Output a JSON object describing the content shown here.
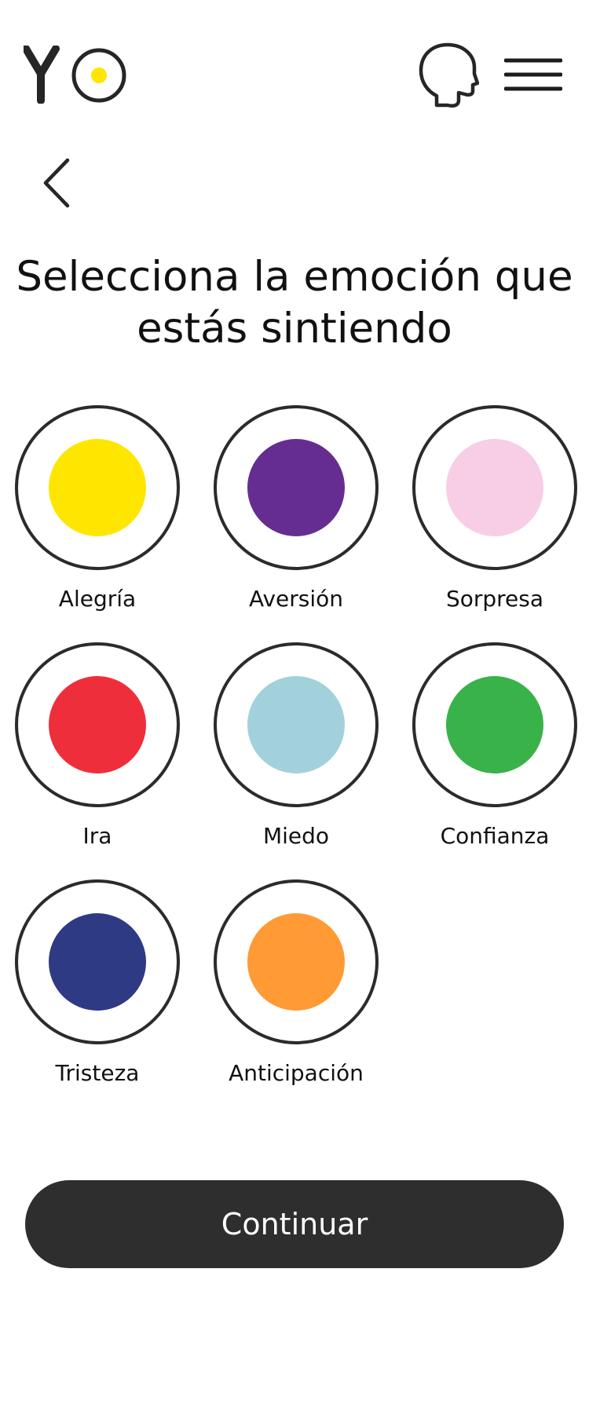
{
  "header": {
    "logo_icon": "yo-egg-logo",
    "logo_yolk_color": "#FFE500",
    "head_icon": "head-profile-icon",
    "menu_icon": "hamburger-menu-icon"
  },
  "navigation": {
    "back_icon": "chevron-left-icon"
  },
  "title": "Selecciona la emoción que estás sintiendo",
  "emotions": [
    {
      "label": "Alegría",
      "color": "#FFE600"
    },
    {
      "label": "Aversión",
      "color": "#662D91"
    },
    {
      "label": "Sorpresa",
      "color": "#F7CEE6"
    },
    {
      "label": "Ira",
      "color": "#EF2E3B"
    },
    {
      "label": "Miedo",
      "color": "#A2D1DC"
    },
    {
      "label": "Confianza",
      "color": "#39B24A"
    },
    {
      "label": "Tristeza",
      "color": "#2E3A84"
    },
    {
      "label": "Anticipación",
      "color": "#FF9A35"
    }
  ],
  "footer": {
    "continue_label": "Continuar",
    "button_color": "#2E2E2E"
  }
}
